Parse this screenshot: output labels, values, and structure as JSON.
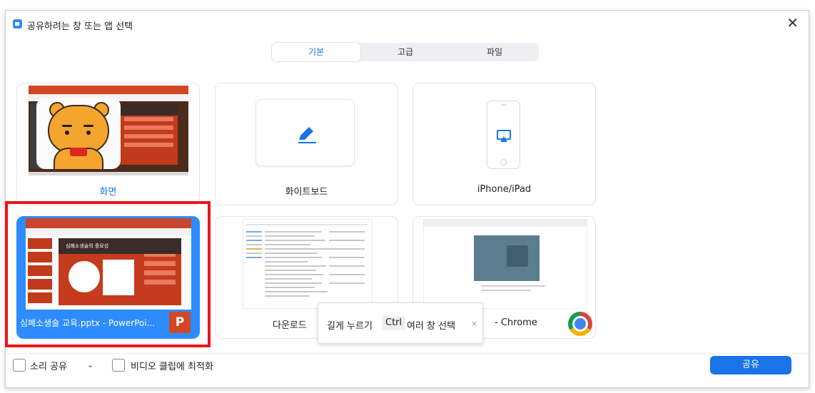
{
  "window": {
    "title": "공유하려는 창 또는 앱 선택"
  },
  "tabs": [
    {
      "label": "기본",
      "active": true
    },
    {
      "label": "고급",
      "active": false
    },
    {
      "label": "파일",
      "active": false
    }
  ],
  "cards": {
    "screen": "화면",
    "whiteboard": "화이트보드",
    "iphone": "iPhone/iPad",
    "ppt": "심폐소생술 교육.pptx - PowerPoi...",
    "ppt_badge": "P",
    "ppt_slide_title": "심폐소생술의 중요성",
    "downloads": "다운로드",
    "chrome": "- Chrome"
  },
  "tooltip": {
    "prefix": "길게 누르기",
    "key": "Ctrl",
    "suffix": "여러 창 선택",
    "close": "×"
  },
  "footer": {
    "sound_share": "소리 공유",
    "video_clip": "비디오 클립에 최적화",
    "share_button": "공유"
  },
  "colors": {
    "accent": "#2D8CFF",
    "share": "#1a73e8",
    "highlight": "#e8161a"
  }
}
